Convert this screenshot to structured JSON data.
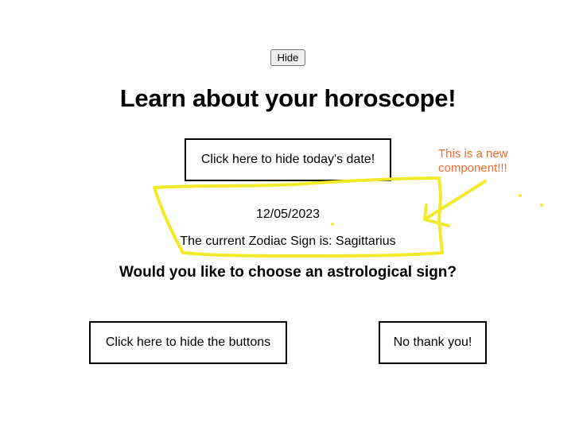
{
  "toggle_button": {
    "label": "Hide"
  },
  "page": {
    "title": "Learn about your horoscope!"
  },
  "date_toggle_button": {
    "label": "Click here to hide today's date!"
  },
  "date_display": "12/05/2023",
  "zodiac_line": "The current Zodiac Sign is: Sagittarius",
  "question": "Would you like to choose an astrological sign?",
  "buttons": {
    "hide_buttons_label": "Click here to hide the buttons",
    "no_thanks_label": "No thank you!"
  },
  "annotation": {
    "note": "This is a new\ncomponent!!!",
    "highlight_color": "#f2ea28",
    "note_color": "#f26a2a"
  }
}
